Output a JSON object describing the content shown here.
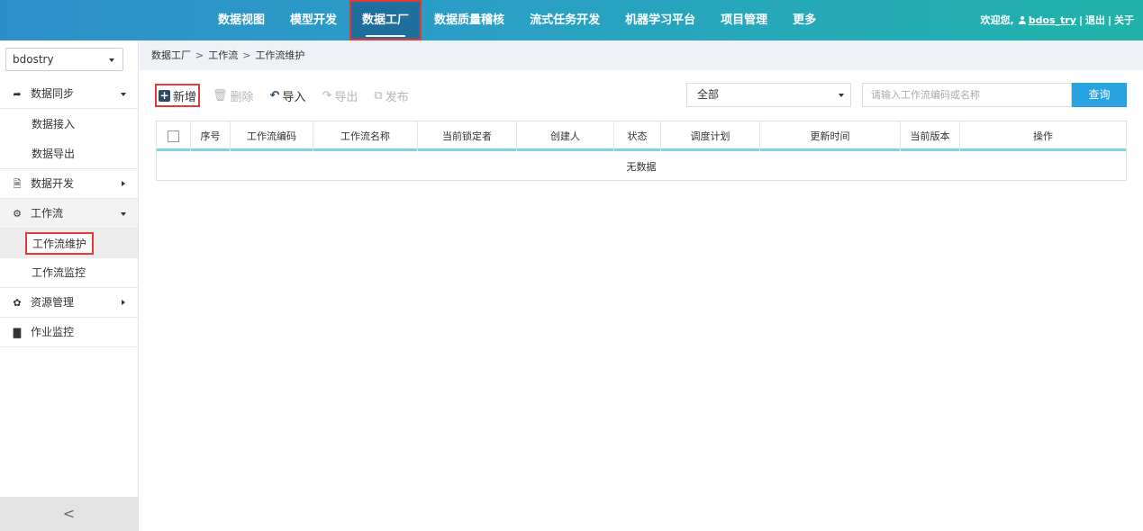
{
  "nav": {
    "items": [
      "数据视图",
      "模型开发",
      "数据工厂",
      "数据质量稽核",
      "流式任务开发",
      "机器学习平台",
      "项目管理",
      "更多"
    ],
    "active": "数据工厂"
  },
  "user": {
    "welcome": "欢迎您,",
    "username": "bdos_try",
    "sep1": "|",
    "logout": "退出",
    "sep2": "|",
    "about": "关于"
  },
  "sidebar": {
    "project": "bdostry",
    "sync": {
      "label": "数据同步",
      "icon": "share-arrow-icon"
    },
    "sync_children": [
      "数据接入",
      "数据导出"
    ],
    "dev": {
      "label": "数据开发",
      "icon": "document-icon"
    },
    "workflow": {
      "label": "工作流",
      "icon": "gears-icon"
    },
    "workflow_children": [
      "工作流维护",
      "工作流监控"
    ],
    "active_item": "工作流维护",
    "resources": {
      "label": "资源管理",
      "icon": "gear-icon"
    },
    "jobs": {
      "label": "作业监控",
      "icon": "clipboard-icon"
    },
    "collapse": "<"
  },
  "breadcrumb": {
    "items": [
      "数据工厂",
      "工作流",
      "工作流维护"
    ],
    "separator": ">"
  },
  "toolbar": {
    "add": "新增",
    "delete": "删除",
    "import": "导入",
    "export": "导出",
    "publish": "发布"
  },
  "filter": {
    "selected": "全部",
    "search_placeholder": "请输入工作流编码或名称",
    "search_button": "查询"
  },
  "table": {
    "columns": [
      "序号",
      "工作流编码",
      "工作流名称",
      "当前锁定者",
      "创建人",
      "状态",
      "调度计划",
      "更新时间",
      "当前版本",
      "操作"
    ],
    "empty": "无数据"
  },
  "colors": {
    "nav_gradient_start": "#2d8fc9",
    "nav_gradient_end": "#21b3a9",
    "nav_active": "#1e6f9e",
    "highlight_red": "#e53935",
    "search_button": "#29a3e0",
    "table_header_border": "#7fd6d8"
  }
}
